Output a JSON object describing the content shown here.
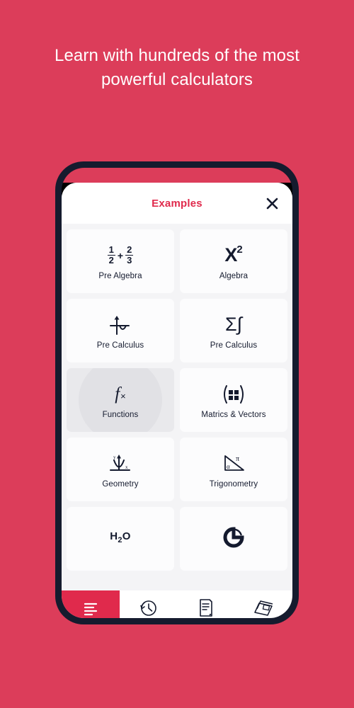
{
  "headline": {
    "line1": "Learn with hundreds of the most",
    "line2": "powerful calculators"
  },
  "colors": {
    "background_red": "#DC3D5A",
    "accent_red": "#E02A4C",
    "phone_frame": "#151B2E",
    "card_bg": "#FCFCFD",
    "grid_bg": "#F4F4F6",
    "pressed_card": "#E9E9EC",
    "ripple": "#E1E1E5",
    "text_dark": "#141A2E"
  },
  "modal": {
    "title": "Examples",
    "close_icon": "close-x-icon"
  },
  "cards": [
    {
      "label": "Pre Algebra",
      "icon": "fraction-sum-icon",
      "num1": "1",
      "den1": "2",
      "plus": "+",
      "num2": "2",
      "den2": "3",
      "pressed": false
    },
    {
      "label": "Algebra",
      "icon": "x-squared-icon",
      "base": "X",
      "exp": "2",
      "pressed": false
    },
    {
      "label": "Pre Calculus",
      "icon": "limit-curve-icon",
      "pressed": false
    },
    {
      "label": "Pre Calculus",
      "icon": "sigma-integral-icon",
      "glyph": "Σ∫",
      "pressed": false
    },
    {
      "label": "Functions",
      "icon": "function-fx-icon",
      "glyph": "f",
      "mult": "×",
      "pressed": true
    },
    {
      "label": "Matrics & Vectors",
      "icon": "matrix-brackets-icon",
      "pressed": false
    },
    {
      "label": "Geometry",
      "icon": "parabola-axes-icon",
      "pressed": false
    },
    {
      "label": "Trigonometry",
      "icon": "right-triangle-icon",
      "pressed": false
    },
    {
      "label": "",
      "icon": "water-molecule-icon",
      "glyph": "H",
      "sub": "2",
      "glyph2": "O",
      "pressed": false
    },
    {
      "label": "",
      "icon": "pie-chart-icon",
      "pressed": false
    }
  ],
  "bottom_nav": [
    {
      "icon": "list-lines-icon",
      "active": true
    },
    {
      "icon": "history-clock-icon",
      "active": false
    },
    {
      "icon": "document-notes-icon",
      "active": false
    },
    {
      "icon": "card-stack-icon",
      "active": false
    }
  ]
}
